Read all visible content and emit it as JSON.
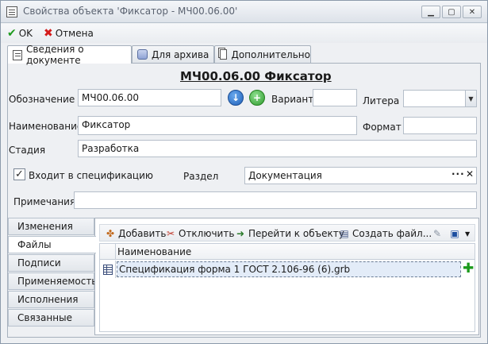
{
  "window": {
    "title": "Свойства объекта 'Фиксатор - МЧ00.06.00'"
  },
  "toolbar": {
    "ok_label": "OK",
    "cancel_label": "Отмена"
  },
  "tabs": [
    {
      "label": "Сведения о документе",
      "icon": "document-icon",
      "active": true
    },
    {
      "label": "Для архива",
      "icon": "archive-icon",
      "active": false
    },
    {
      "label": "Дополнительно",
      "icon": "pages-icon",
      "active": false
    }
  ],
  "document": {
    "header": "МЧ00.06.00 Фиксатор",
    "designation_label": "Обозначение",
    "designation_value": "МЧ00.06.00",
    "variant_label": "Вариант",
    "variant_value": "",
    "litera_label": "Литера",
    "litera_value": "",
    "name_label": "Наименование",
    "name_value": "Фиксатор",
    "format_label": "Формат",
    "format_value": "",
    "stage_label": "Стадия",
    "stage_value": "Разработка",
    "in_spec_label": "Входит в спецификацию",
    "in_spec_checked": true,
    "section_label": "Раздел",
    "section_value": "Документация",
    "notes_label": "Примечания",
    "notes_value": ""
  },
  "side_tabs": [
    {
      "label": "Изменения",
      "active": false
    },
    {
      "label": "Файлы",
      "active": true
    },
    {
      "label": "Подписи",
      "active": false
    },
    {
      "label": "Применяемость",
      "active": false
    },
    {
      "label": "Исполнения",
      "active": false
    },
    {
      "label": "Связанные",
      "active": false
    }
  ],
  "files": {
    "toolbar": {
      "add_label": "Добавить",
      "disconnect_label": "Отключить",
      "goto_label": "Перейти к объекту",
      "create_label": "Создать файл..."
    },
    "column_header": "Наименование",
    "rows": [
      {
        "name": "Спецификация форма 1 ГОСТ 2.106-96 (6).grb"
      }
    ]
  },
  "colors": {
    "accent_blue": "#1e5fb8",
    "accent_green": "#2f9a2f",
    "cancel_red": "#d41a1a"
  }
}
